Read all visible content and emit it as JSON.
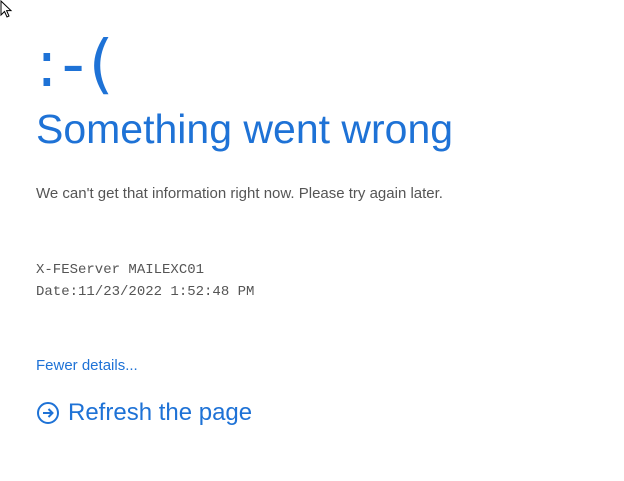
{
  "cursor": {
    "icon": "mouse-pointer-icon"
  },
  "error": {
    "face": ":-(",
    "title": "Something went wrong",
    "message": "We can't get that information right now. Please try again later."
  },
  "details": {
    "server_line": "X-FEServer MAILEXC01",
    "date_line": "Date:11/23/2022 1:52:48 PM"
  },
  "links": {
    "fewer_details": "Fewer details...",
    "refresh": "Refresh the page",
    "refresh_icon": "circle-arrow-right-icon"
  },
  "colors": {
    "accent": "#1e72d6",
    "text_gray": "#555555",
    "background": "#ffffff"
  }
}
